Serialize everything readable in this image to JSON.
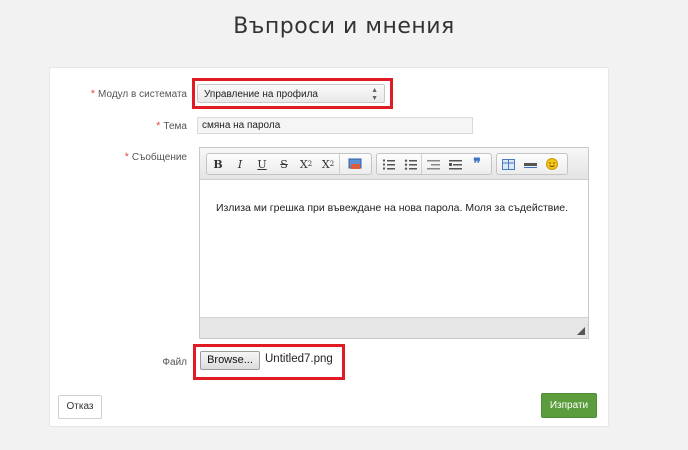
{
  "page": {
    "title": "Въпроси и мнения"
  },
  "form": {
    "module": {
      "label": "Модул в системата",
      "value": "Управление на профила",
      "required_mark": "*"
    },
    "topic": {
      "label": "Тема",
      "value": "смяна на парола",
      "required_mark": "*"
    },
    "message": {
      "label": "Съобщение",
      "required_mark": "*",
      "value": "Излиза ми грешка при въвеждане на нова парола. Моля за съдействие.",
      "toolbar": {
        "bold": "B",
        "italic": "I",
        "underline": "U",
        "strike": "S",
        "subscript": "X",
        "superscript": "X"
      }
    },
    "file": {
      "label": "Файл",
      "browse_label": "Browse...",
      "file_name": "Untitled7.png"
    }
  },
  "actions": {
    "cancel_label": "Отказ",
    "send_label": "Изпрати"
  },
  "colors": {
    "highlight": "#e01b24",
    "send_button": "#5b9c3c"
  }
}
